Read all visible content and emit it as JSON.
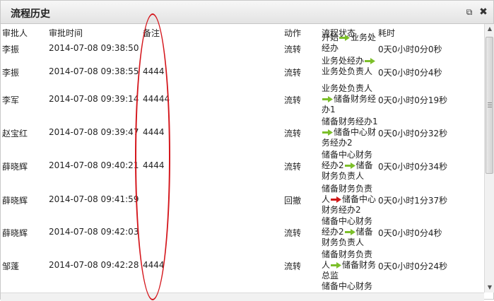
{
  "window": {
    "title": "流程历史",
    "popout_icon": "popout-icon",
    "close_icon": "close-icon"
  },
  "columns": {
    "approver": "审批人",
    "time": "审批时间",
    "remark": "备注",
    "action": "动作",
    "status": "流程状态",
    "duration": "耗时"
  },
  "rows": [
    {
      "approver": "李振",
      "time": "2014-07-08 09:38:50",
      "remark": "",
      "action": "流转",
      "from": "开始",
      "arrow": "green",
      "to": "业务处经办",
      "duration": "0天0小时0分0秒"
    },
    {
      "approver": "李振",
      "time": "2014-07-08 09:38:55",
      "remark": "4444",
      "action": "流转",
      "from": "业务处经办",
      "arrow": "green",
      "to": "业务处负责人",
      "duration": "0天0小时0分4秒"
    },
    {
      "approver": "李军",
      "time": "2014-07-08 09:39:14",
      "remark": "44444",
      "action": "流转",
      "from": "业务处负责人",
      "arrow": "green",
      "to": "储备财务经办1",
      "duration": "0天0小时0分19秒"
    },
    {
      "approver": "赵宝红",
      "time": "2014-07-08 09:39:47",
      "remark": "4444",
      "action": "流转",
      "from": "储备财务经办1",
      "arrow": "green",
      "to": "储备中心财务经办2",
      "duration": "0天0小时0分32秒"
    },
    {
      "approver": "薛晓辉",
      "time": "2014-07-08 09:40:21",
      "remark": "4444",
      "action": "流转",
      "from": "储备中心财务经办2",
      "arrow": "green",
      "to": "储备财务负责人",
      "duration": "0天0小时0分34秒"
    },
    {
      "approver": "薛晓辉",
      "time": "2014-07-08 09:41:59",
      "remark": "",
      "action": "回撤",
      "from": "储备财务负责人",
      "arrow": "red",
      "to": "储备中心财务经办2",
      "duration": "0天0小时1分37秒"
    },
    {
      "approver": "薛晓辉",
      "time": "2014-07-08 09:42:03",
      "remark": "",
      "action": "流转",
      "from": "储备中心财务经办2",
      "arrow": "green",
      "to": "储备财务负责人",
      "duration": "0天0小时0分4秒"
    },
    {
      "approver": "邹蓬",
      "time": "2014-07-08 09:42:28",
      "remark": "4444",
      "action": "流转",
      "from": "储备财务负责人",
      "arrow": "green",
      "to": "储备财务总监",
      "duration": "0天0小时0分24秒"
    }
  ],
  "partial_row_status": "储备中心财务",
  "colors": {
    "arrow_green": "#7cbf2a",
    "arrow_red": "#d01818",
    "annotation": "#d4161c"
  }
}
